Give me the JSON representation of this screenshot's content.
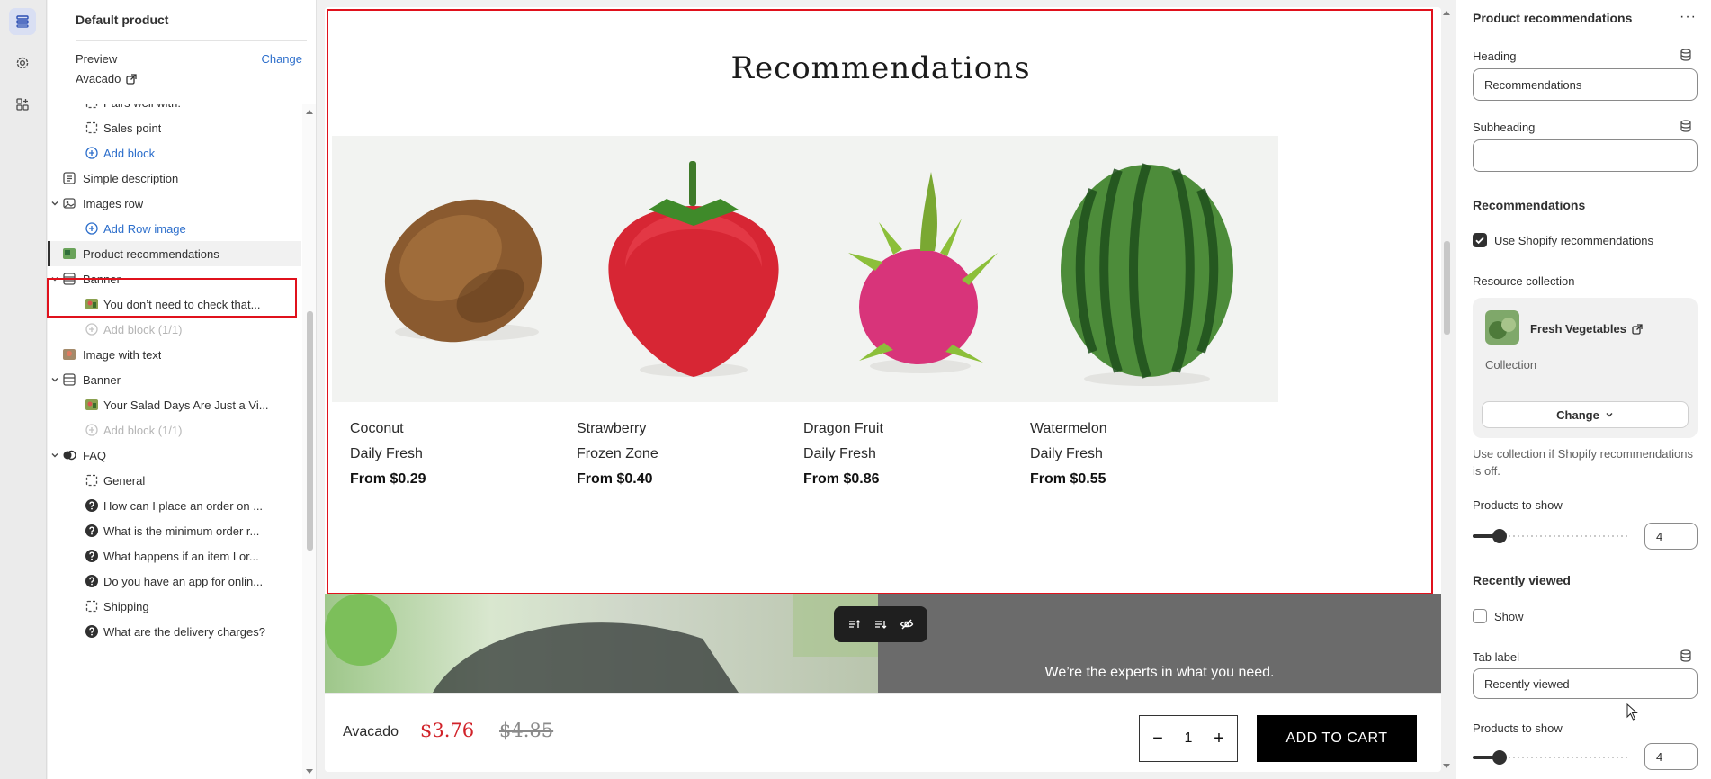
{
  "left_panel": {
    "title": "Default product",
    "preview_label": "Preview",
    "change_link": "Change",
    "preview_value": "Avacado",
    "tree": [
      {
        "label": "Pairs well with:",
        "icon": "block-icon",
        "level": 2
      },
      {
        "label": "Sales point",
        "icon": "block-icon",
        "level": 2
      },
      {
        "label": "Add block",
        "icon": "add-circle-icon",
        "level": 2,
        "style": "blue"
      },
      {
        "label": "Simple description",
        "icon": "section-text-icon",
        "level": 1
      },
      {
        "label": "Images row",
        "icon": "image-section-icon",
        "level": 1,
        "expanded": true
      },
      {
        "label": "Add Row image",
        "icon": "add-circle-icon",
        "level": 2,
        "style": "blue"
      },
      {
        "label": "Product recommendations",
        "icon": "product-thumb-icon",
        "level": 1,
        "selected": true
      },
      {
        "label": "Banner",
        "icon": "banner-section-icon",
        "level": 1,
        "expanded": true
      },
      {
        "label": "You don’t need to check that...",
        "icon": "image-thumb-icon",
        "level": 2
      },
      {
        "label": "Add block (1/1)",
        "icon": "add-circle-icon",
        "level": 2,
        "style": "muted"
      },
      {
        "label": "Image with text",
        "icon": "image-text-thumb-icon",
        "level": 1
      },
      {
        "label": "Banner",
        "icon": "banner-section-icon",
        "level": 1,
        "expanded": true
      },
      {
        "label": "Your Salad Days Are Just a Vi...",
        "icon": "image-thumb-icon",
        "level": 2
      },
      {
        "label": "Add block (1/1)",
        "icon": "add-circle-icon",
        "level": 2,
        "style": "muted"
      },
      {
        "label": "FAQ",
        "icon": "faq-section-icon",
        "level": 1,
        "expanded": true
      },
      {
        "label": "General",
        "icon": "block-icon",
        "level": 2
      },
      {
        "label": "How can I place an order on ...",
        "icon": "question-icon",
        "level": 2
      },
      {
        "label": "What is the minimum order r...",
        "icon": "question-icon",
        "level": 2
      },
      {
        "label": "What happens if an item I or...",
        "icon": "question-icon",
        "level": 2
      },
      {
        "label": "Do you have an app for onlin...",
        "icon": "question-icon",
        "level": 2
      },
      {
        "label": "Shipping",
        "icon": "block-icon",
        "level": 2
      },
      {
        "label": "What are the delivery charges?",
        "icon": "question-icon",
        "level": 2
      }
    ]
  },
  "preview": {
    "heading": "Recommendations",
    "products": [
      {
        "name": "Coconut",
        "vendor": "Daily Fresh",
        "price": "From $0.29",
        "image": "coconut"
      },
      {
        "name": "Strawberry",
        "vendor": "Frozen Zone",
        "price": "From $0.40",
        "image": "strawberry"
      },
      {
        "name": "Dragon Fruit",
        "vendor": "Daily Fresh",
        "price": "From $0.86",
        "image": "dragon-fruit"
      },
      {
        "name": "Watermelon",
        "vendor": "Daily Fresh",
        "price": "From $0.55",
        "image": "watermelon"
      }
    ],
    "banner_text": "We’re the experts in what you need.",
    "sticky": {
      "title": "Avacado",
      "sale_price": "$3.76",
      "compare_price": "$4.85",
      "quantity": "1",
      "add_to_cart": "ADD TO CART"
    }
  },
  "right_panel": {
    "title": "Product recommendations",
    "more": "···",
    "heading_label": "Heading",
    "heading_value": "Recommendations",
    "subheading_label": "Subheading",
    "subheading_value": "",
    "recommendations_title": "Recommendations",
    "use_shopify_label": "Use Shopify recommendations",
    "use_shopify_checked": true,
    "resource_collection_label": "Resource collection",
    "collection_name": "Fresh Vegetables",
    "collection_type": "Collection",
    "change_button": "Change",
    "help_text": "Use collection if Shopify recommendations is off.",
    "products_to_show_label": "Products to show",
    "products_to_show_value": "4",
    "recently_viewed_title": "Recently viewed",
    "show_label": "Show",
    "show_checked": false,
    "tab_label_label": "Tab label",
    "tab_label_value": "Recently viewed",
    "products_to_show_label_2": "Products to show",
    "products_to_show_value_2": "4"
  },
  "colors": {
    "accent_link": "#2c6ecb",
    "selection_outline": "#e0111c",
    "sale_price": "#d1232a",
    "button_dark": "#000000"
  }
}
